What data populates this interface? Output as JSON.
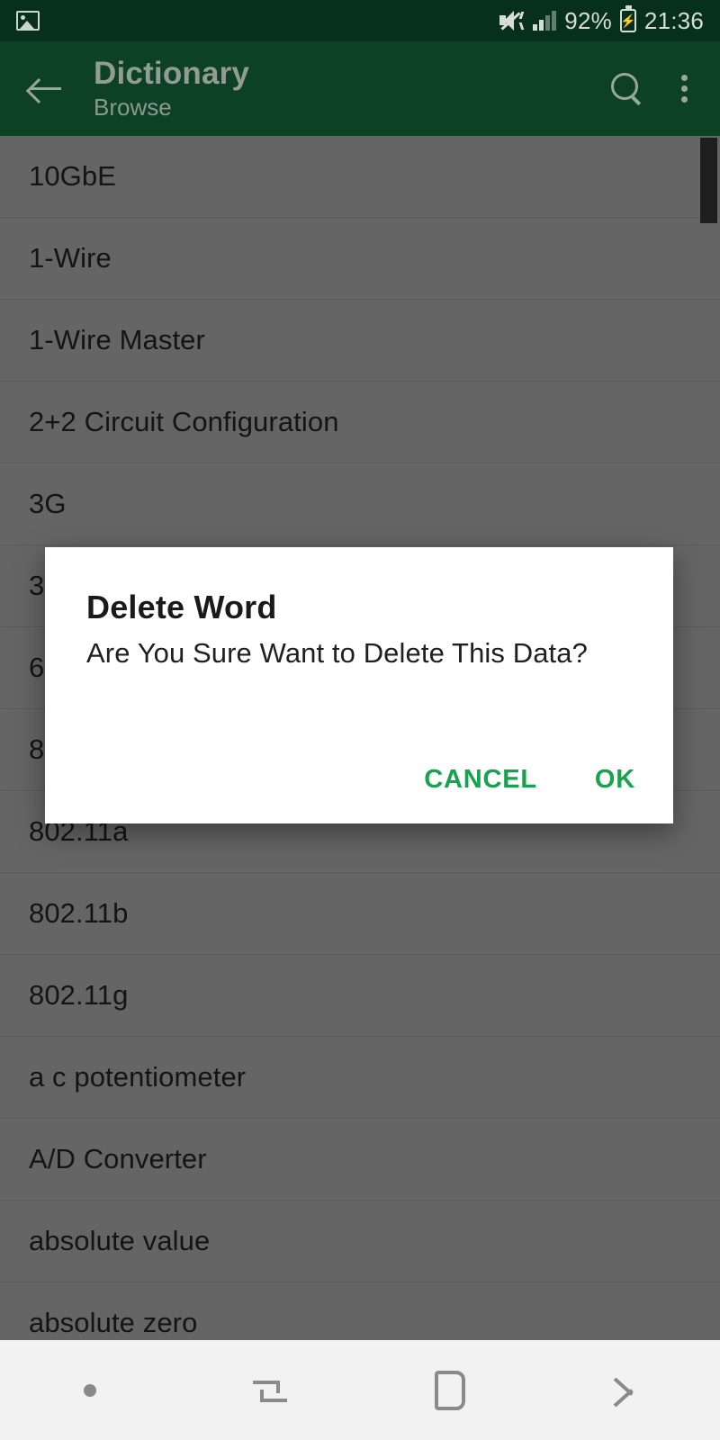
{
  "status_bar": {
    "notification_icon": "photo-icon",
    "sound_icon": "mute-vibrate-icon",
    "signal_icon": "cell-signal-icon",
    "battery_percent": "92%",
    "battery_icon": "charging-battery-icon",
    "time": "21:36",
    "background_color": "#06301a"
  },
  "app_bar": {
    "back_icon": "arrow-left-icon",
    "title": "Dictionary",
    "subtitle": "Browse",
    "search_icon": "search-icon",
    "overflow_icon": "kebab-menu-icon",
    "background_color": "#0c4223"
  },
  "list": {
    "items": [
      {
        "label": "10GbE"
      },
      {
        "label": "1-Wire"
      },
      {
        "label": "1-Wire Master"
      },
      {
        "label": "2+2 Circuit Configuration"
      },
      {
        "label": "3G"
      },
      {
        "label": "3"
      },
      {
        "label": "6"
      },
      {
        "label": "8"
      },
      {
        "label": "802.11a"
      },
      {
        "label": "802.11b"
      },
      {
        "label": "802.11g"
      },
      {
        "label": "a c potentiometer"
      },
      {
        "label": "A/D Converter"
      },
      {
        "label": "absolute value"
      },
      {
        "label": "absolute zero"
      }
    ],
    "scrollbar": "vertical-scrollbar",
    "background_color": "#656565"
  },
  "dialog": {
    "title": "Delete Word",
    "message": "Are You Sure Want to Delete This Data?",
    "cancel_label": "CANCEL",
    "ok_label": "OK",
    "accent_color": "#17a24f",
    "background_color": "#ffffff"
  },
  "nav_bar": {
    "dot_icon": "nav-dot-icon",
    "recents_icon": "recents-icon",
    "home_icon": "home-icon",
    "back_icon": "back-arrow-icon",
    "background_color": "#f2f2f2"
  }
}
